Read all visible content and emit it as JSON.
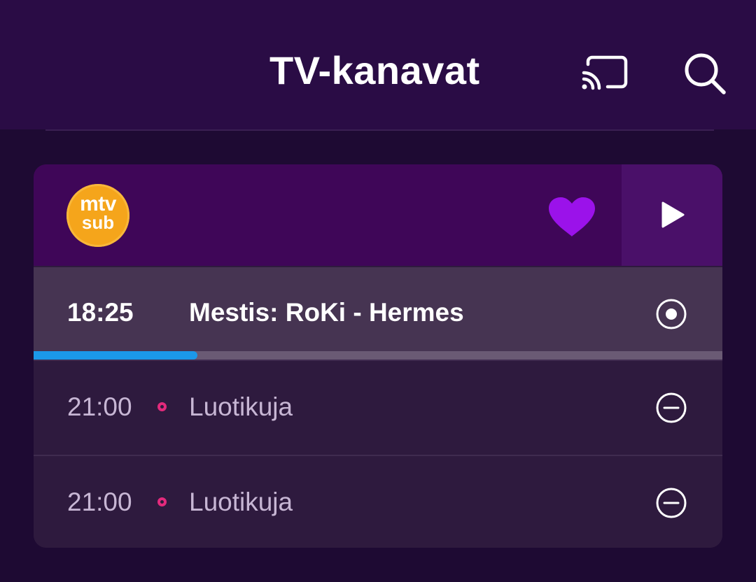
{
  "header": {
    "title": "TV-kanavat",
    "cast_icon": "cast-icon",
    "search_icon": "search-icon"
  },
  "channel": {
    "logo_text_top": "mtv",
    "logo_text_bottom": "sub",
    "favorite_icon": "heart-icon",
    "favorite": true,
    "play_icon": "play-icon",
    "colors": {
      "logo": "#f5a51b",
      "heart": "#9b12ea",
      "progress": "#1b98e9",
      "record": "#e32a7c"
    }
  },
  "programs": [
    {
      "time": "18:25",
      "title": "Mestis: RoKi - Hermes",
      "status_icon": "live-radio-icon",
      "current": true,
      "progress": 0.238
    },
    {
      "time": "21:00",
      "title": "Luotikuja",
      "status_icon": "minus-circle-icon",
      "recording": true
    },
    {
      "time": "21:00",
      "title": "Luotikuja",
      "status_icon": "minus-circle-icon",
      "recording": true
    }
  ]
}
